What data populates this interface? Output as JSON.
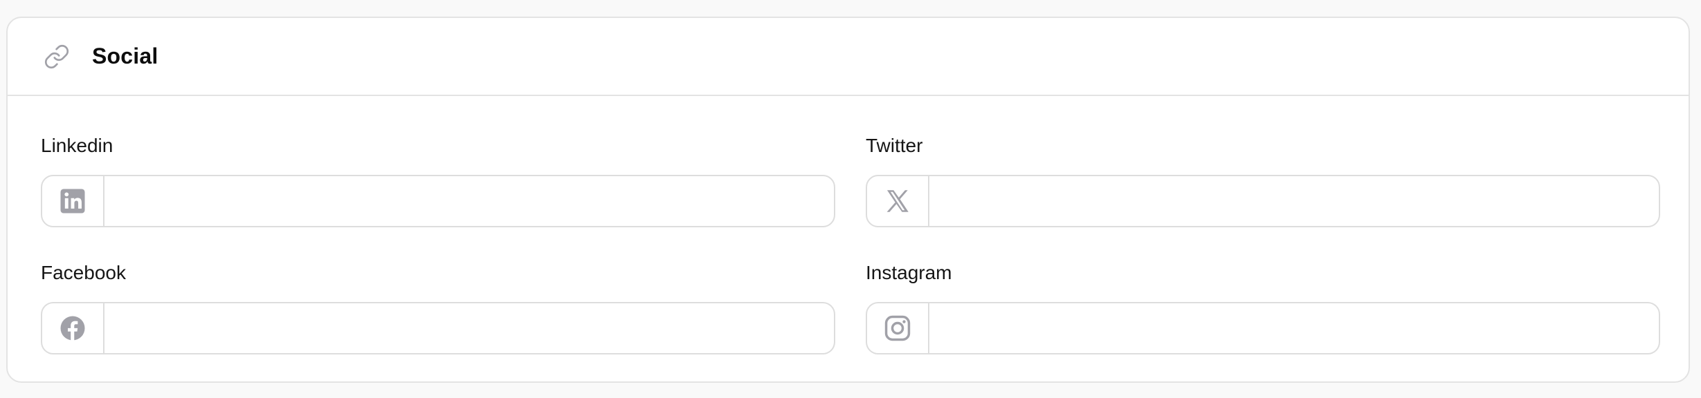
{
  "card": {
    "title": "Social",
    "icon": "link-icon"
  },
  "colors": {
    "icon_gray": "#a1a1a8",
    "border": "#e3e3e3",
    "background": "#f9f9f9"
  },
  "fields": {
    "linkedin": {
      "label": "Linkedin",
      "value": "",
      "placeholder": "",
      "icon": "linkedin-icon"
    },
    "twitter": {
      "label": "Twitter",
      "value": "",
      "placeholder": "",
      "icon": "x-twitter-icon"
    },
    "facebook": {
      "label": "Facebook",
      "value": "",
      "placeholder": "",
      "icon": "facebook-icon"
    },
    "instagram": {
      "label": "Instagram",
      "value": "",
      "placeholder": "",
      "icon": "instagram-icon"
    }
  }
}
